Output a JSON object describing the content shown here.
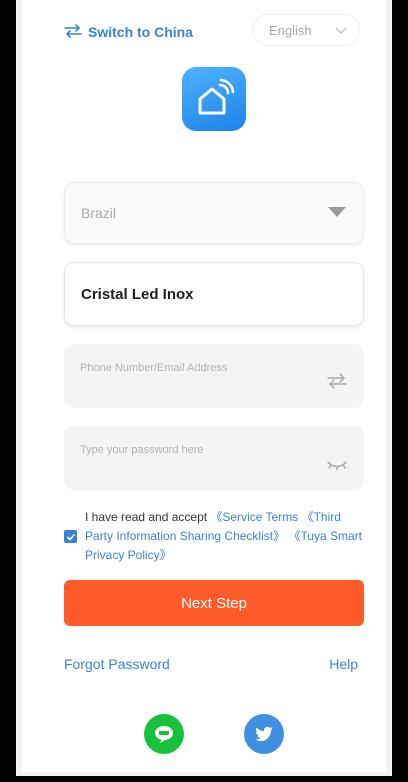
{
  "header": {
    "switch_label": "Switch to China",
    "language": "English"
  },
  "form": {
    "country": "Brazil",
    "name_value": "Cristal Led Inox",
    "phone_placeholder": "Phone Number/Email Address",
    "password_placeholder": "Type your password here"
  },
  "agreement": {
    "checked": true,
    "text": "I have read and accept ",
    "service_terms": "《Service Terms",
    "third_party": "《Third Party Information Sharing Checklist》",
    "privacy": "《Tuya Smart Privacy Policy》"
  },
  "actions": {
    "next": "Next Step",
    "forgot": "Forgot Password",
    "help": "Help"
  },
  "social": [
    {
      "name": "line",
      "icon": "line-icon",
      "color": "#18c13a"
    },
    {
      "name": "twitter",
      "icon": "twitter-icon",
      "color": "#3f8fe0"
    }
  ],
  "colors": {
    "accent": "#3b82d6",
    "primary_button": "#ff5a2a"
  }
}
